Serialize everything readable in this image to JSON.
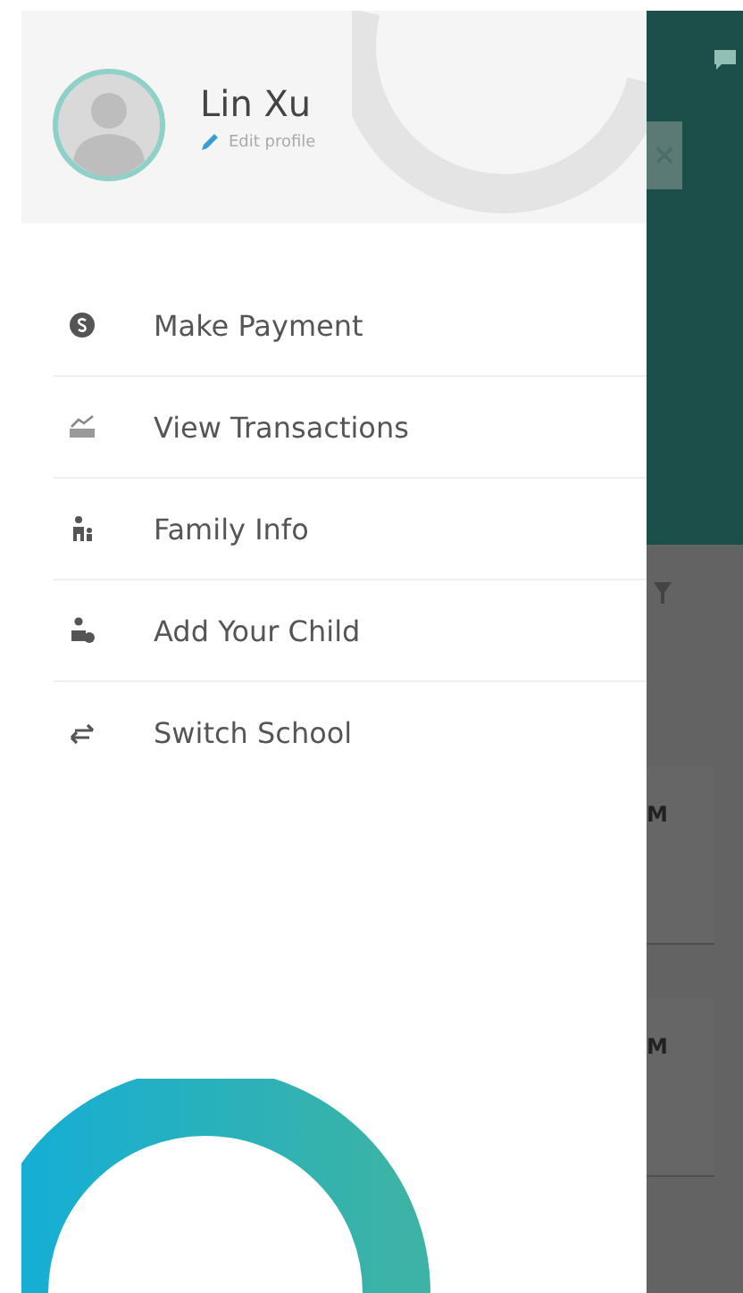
{
  "profile": {
    "name": "Lin Xu",
    "edit_label": "Edit profile"
  },
  "menu": [
    {
      "kind": "payment",
      "label": "Make Payment"
    },
    {
      "kind": "transactions",
      "label": "View Transactions"
    },
    {
      "kind": "family",
      "label": "Family Info"
    },
    {
      "kind": "child",
      "label": "Add Your Child"
    },
    {
      "kind": "switch",
      "label": "Switch School"
    }
  ],
  "background_cards": [
    {
      "text": "M"
    },
    {
      "text": "M"
    }
  ]
}
